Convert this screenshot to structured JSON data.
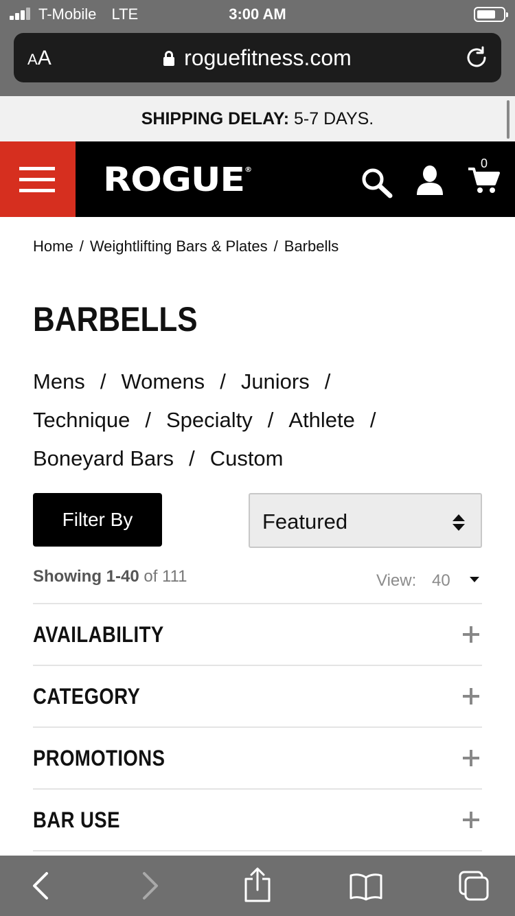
{
  "status_bar": {
    "carrier": "T-Mobile",
    "network": "LTE",
    "time": "3:00 AM"
  },
  "browser": {
    "text_size_small": "A",
    "text_size_large": "A",
    "url": "roguefitness.com"
  },
  "banner": {
    "label": "SHIPPING DELAY:",
    "value": " 5-7 DAYS."
  },
  "header": {
    "logo": "ROGUE",
    "logo_mark": "®",
    "cart_count": "0"
  },
  "breadcrumb": {
    "items": [
      "Home",
      "Weightlifting Bars & Plates",
      "Barbells"
    ],
    "separator": "/"
  },
  "page": {
    "title": "BARBELLS"
  },
  "subcategories": {
    "items": [
      "Mens",
      "Womens",
      "Juniors",
      "Technique",
      "Specialty",
      "Athlete",
      "Boneyard Bars",
      "Custom"
    ],
    "separator": "/"
  },
  "controls": {
    "filter_label": "Filter By",
    "sort_value": "Featured"
  },
  "results": {
    "showing_range": "Showing 1-40",
    "showing_total": " of 111",
    "view_label": "View:",
    "view_value": "40"
  },
  "facets": [
    "AVAILABILITY",
    "CATEGORY",
    "PROMOTIONS",
    "BAR USE"
  ],
  "icons": {
    "menu": "hamburger-icon",
    "search": "search-icon",
    "account": "user-icon",
    "cart": "cart-icon",
    "back": "chevron-left-icon",
    "forward": "chevron-right-icon",
    "share": "share-icon",
    "bookmarks": "book-icon",
    "tabs": "tabs-icon",
    "reload": "reload-icon",
    "lock": "lock-icon"
  },
  "colors": {
    "brand_red": "#d62f1f",
    "header_bg": "#000000",
    "banner_bg": "#f1f1f1"
  }
}
